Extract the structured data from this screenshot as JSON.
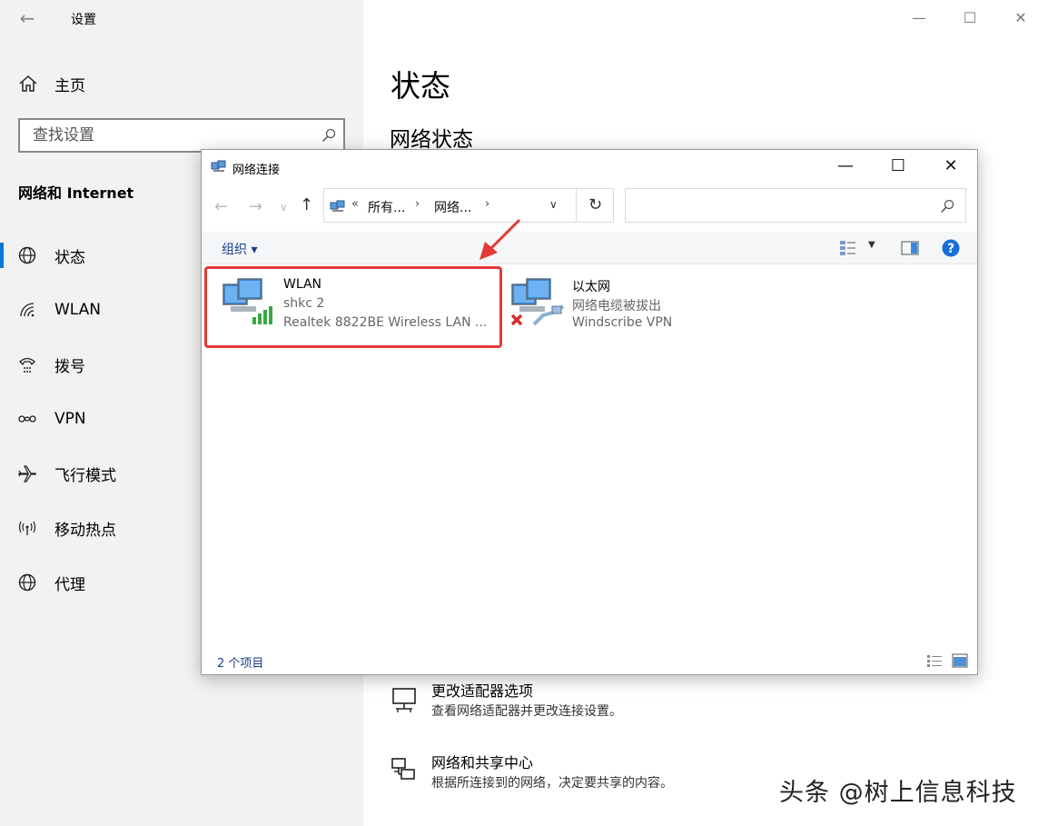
{
  "settings": {
    "window_title": "设置",
    "home_label": "主页",
    "search_placeholder": "查找设置",
    "section_title": "网络和 Internet",
    "nav": [
      {
        "label": "状态",
        "icon": "globe-icon"
      },
      {
        "label": "WLAN",
        "icon": "wifi-icon"
      },
      {
        "label": "拨号",
        "icon": "dialup-icon"
      },
      {
        "label": "VPN",
        "icon": "vpn-icon"
      },
      {
        "label": "飞行模式",
        "icon": "airplane-icon"
      },
      {
        "label": "移动热点",
        "icon": "hotspot-icon"
      },
      {
        "label": "代理",
        "icon": "globe-icon"
      }
    ],
    "content_title": "状态",
    "content_subtitle": "网络状态",
    "adv": [
      {
        "title": "更改适配器选项",
        "desc": "查看网络适配器并更改连接设置。",
        "icon": "adapter-icon"
      },
      {
        "title": "网络和共享中心",
        "desc": "根据所连接到的网络，决定要共享的内容。",
        "icon": "sharing-center-icon"
      }
    ]
  },
  "explorer": {
    "title": "网络连接",
    "breadcrumb": {
      "prefix": "«",
      "crumb1": "所有...",
      "crumb2": "网络..."
    },
    "toolbar": {
      "organize": "组织 ▾"
    },
    "items": [
      {
        "name": "WLAN",
        "status": "shkc 2",
        "device": "Realtek 8822BE Wireless LAN ..."
      },
      {
        "name": "以太网",
        "status": "网络电缆被拔出",
        "device": "Windscribe VPN"
      }
    ],
    "status_count": "2 个项目"
  },
  "watermark": "头条 @树上信息科技",
  "colors": {
    "accent": "#0078d7",
    "highlight": "#e53935",
    "sidebar_bg": "#f2f2f2"
  }
}
